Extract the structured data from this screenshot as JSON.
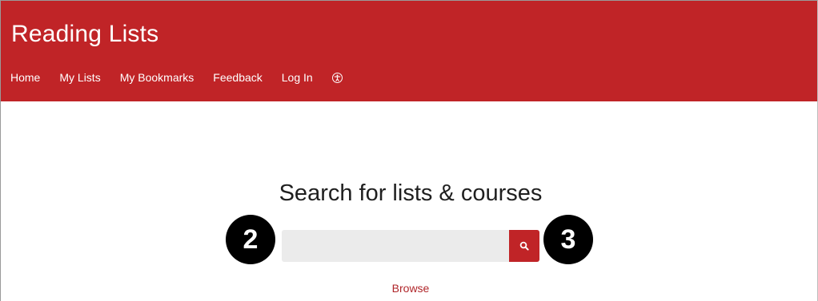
{
  "header": {
    "title": "Reading Lists",
    "background_color": "#c02427"
  },
  "nav": {
    "items": [
      {
        "label": "Home"
      },
      {
        "label": "My Lists"
      },
      {
        "label": "My Bookmarks"
      },
      {
        "label": "Feedback"
      },
      {
        "label": "Log In"
      }
    ],
    "accessibility_icon": "accessibility-icon"
  },
  "search": {
    "heading": "Search for lists & courses",
    "input_value": "",
    "button_icon": "search-icon"
  },
  "annotations": {
    "badge_left": "2",
    "badge_right": "3"
  },
  "browse": {
    "label": "Browse"
  }
}
